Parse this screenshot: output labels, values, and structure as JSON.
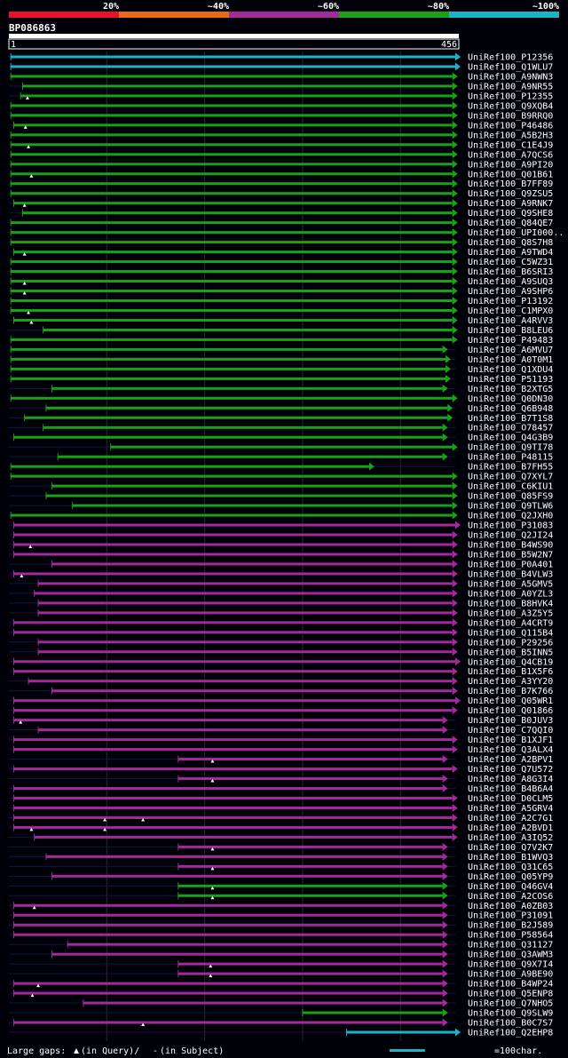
{
  "chart_data": {
    "type": "alignment-overview",
    "query_id": "BP086863",
    "query_length": 456,
    "ruler_start_label": "1",
    "ruler_end_label": "456",
    "identity_legend": [
      {
        "label": "20%",
        "color": "#e8102c"
      },
      {
        "label": "~40%",
        "color": "#e46c15"
      },
      {
        "label": "~60%",
        "color": "#a52a99"
      },
      {
        "label": "~80%",
        "color": "#19a11a"
      },
      {
        "label": "~100%",
        "color": "#1ab5c5"
      }
    ],
    "legend_text": "Large gaps:",
    "legend_query": "(in Query)/",
    "legend_subject_mark": "-",
    "legend_subject": "(in Subject)",
    "scale_label": "=100char.",
    "scale_value": 100,
    "hits": [
      {
        "id": "UniRef100_P12356",
        "s": 2,
        "e": 456,
        "c": "cyan"
      },
      {
        "id": "UniRef100_Q1WLU7",
        "s": 2,
        "e": 456,
        "c": "cyan"
      },
      {
        "id": "UniRef100_A9NWN3",
        "s": 2,
        "e": 453,
        "c": "green"
      },
      {
        "id": "UniRef100_A9NR55",
        "s": 14,
        "e": 453,
        "c": "green"
      },
      {
        "id": "UniRef100_P12355",
        "s": 12,
        "e": 453,
        "c": "green",
        "q": [
          19
        ]
      },
      {
        "id": "UniRef100_Q9XQB4",
        "s": 2,
        "e": 453,
        "c": "green"
      },
      {
        "id": "UniRef100_B9RRQ0",
        "s": 2,
        "e": 453,
        "c": "green"
      },
      {
        "id": "UniRef100_P46486",
        "s": 5,
        "e": 453,
        "c": "green",
        "q": [
          17
        ]
      },
      {
        "id": "UniRef100_A5B2H3",
        "s": 2,
        "e": 453,
        "c": "green"
      },
      {
        "id": "UniRef100_C1E4J9",
        "s": 2,
        "e": 453,
        "c": "green",
        "q": [
          20
        ]
      },
      {
        "id": "UniRef100_A7QCS6",
        "s": 2,
        "e": 453,
        "c": "green"
      },
      {
        "id": "UniRef100_A9PI20",
        "s": 2,
        "e": 453,
        "c": "green"
      },
      {
        "id": "UniRef100_Q01B61",
        "s": 2,
        "e": 453,
        "c": "green",
        "q": [
          23
        ]
      },
      {
        "id": "UniRef100_B7FF89",
        "s": 2,
        "e": 453,
        "c": "green"
      },
      {
        "id": "UniRef100_Q9ZSU5",
        "s": 2,
        "e": 453,
        "c": "green"
      },
      {
        "id": "UniRef100_A9RNK7",
        "s": 5,
        "e": 453,
        "c": "green",
        "q": [
          16
        ]
      },
      {
        "id": "UniRef100_Q9SHE8",
        "s": 14,
        "e": 453,
        "c": "green"
      },
      {
        "id": "UniRef100_Q84QE7",
        "s": 2,
        "e": 453,
        "c": "green"
      },
      {
        "id": "UniRef100_UPI000..",
        "s": 2,
        "e": 453,
        "c": "green"
      },
      {
        "id": "UniRef100_Q8S7H8",
        "s": 2,
        "e": 453,
        "c": "green"
      },
      {
        "id": "UniRef100_A9TWD4",
        "s": 5,
        "e": 453,
        "c": "green",
        "q": [
          16
        ]
      },
      {
        "id": "UniRef100_C5WZ31",
        "s": 2,
        "e": 453,
        "c": "green"
      },
      {
        "id": "UniRef100_B6SRI3",
        "s": 2,
        "e": 453,
        "c": "green"
      },
      {
        "id": "UniRef100_A9SUQ3",
        "s": 2,
        "e": 453,
        "c": "green",
        "q": [
          16
        ]
      },
      {
        "id": "UniRef100_A9SHP6",
        "s": 2,
        "e": 453,
        "c": "green",
        "q": [
          16
        ]
      },
      {
        "id": "UniRef100_P13192",
        "s": 2,
        "e": 453,
        "c": "green"
      },
      {
        "id": "UniRef100_C1MPX0",
        "s": 2,
        "e": 453,
        "c": "green",
        "q": [
          20
        ]
      },
      {
        "id": "UniRef100_A4RVV3",
        "s": 5,
        "e": 453,
        "c": "green",
        "q": [
          23
        ]
      },
      {
        "id": "UniRef100_B8LEU6",
        "s": 35,
        "e": 453,
        "c": "green"
      },
      {
        "id": "UniRef100_P49483",
        "s": 2,
        "e": 453,
        "c": "green"
      },
      {
        "id": "UniRef100_A6MVU7",
        "s": 2,
        "e": 443,
        "c": "green"
      },
      {
        "id": "UniRef100_A0T0M1",
        "s": 2,
        "e": 446,
        "c": "green"
      },
      {
        "id": "UniRef100_Q1XDU4",
        "s": 2,
        "e": 446,
        "c": "green"
      },
      {
        "id": "UniRef100_P51193",
        "s": 2,
        "e": 446,
        "c": "green"
      },
      {
        "id": "UniRef100_B2XTG5",
        "s": 44,
        "e": 443,
        "c": "green"
      },
      {
        "id": "UniRef100_Q0DN30",
        "s": 2,
        "e": 453,
        "c": "green"
      },
      {
        "id": "UniRef100_Q6B948",
        "s": 38,
        "e": 448,
        "c": "green"
      },
      {
        "id": "UniRef100_B7T1S8",
        "s": 16,
        "e": 448,
        "c": "green"
      },
      {
        "id": "UniRef100_O78457",
        "s": 35,
        "e": 443,
        "c": "green"
      },
      {
        "id": "UniRef100_Q4G3B9",
        "s": 5,
        "e": 443,
        "c": "green"
      },
      {
        "id": "UniRef100_Q9TI78",
        "s": 104,
        "e": 453,
        "c": "green"
      },
      {
        "id": "UniRef100_P48115",
        "s": 50,
        "e": 443,
        "c": "green"
      },
      {
        "id": "UniRef100_B7FH55",
        "s": 2,
        "e": 368,
        "c": "green"
      },
      {
        "id": "UniRef100_Q7XYL7",
        "s": 2,
        "e": 453,
        "c": "green"
      },
      {
        "id": "UniRef100_C6KIU1",
        "s": 44,
        "e": 453,
        "c": "green"
      },
      {
        "id": "UniRef100_Q85FS9",
        "s": 38,
        "e": 453,
        "c": "green"
      },
      {
        "id": "UniRef100_Q9TLW6",
        "s": 65,
        "e": 453,
        "c": "green"
      },
      {
        "id": "UniRef100_Q2JXH0",
        "s": 2,
        "e": 453,
        "c": "green"
      },
      {
        "id": "UniRef100_P31083",
        "s": 5,
        "e": 456,
        "c": "magenta"
      },
      {
        "id": "UniRef100_Q2JI24",
        "s": 5,
        "e": 453,
        "c": "magenta"
      },
      {
        "id": "UniRef100_B4WS90",
        "s": 5,
        "e": 453,
        "c": "magenta",
        "q": [
          22
        ]
      },
      {
        "id": "UniRef100_B5W2N7",
        "s": 5,
        "e": 453,
        "c": "magenta"
      },
      {
        "id": "UniRef100_P0A401",
        "s": 44,
        "e": 453,
        "c": "magenta"
      },
      {
        "id": "UniRef100_B4VLW3",
        "s": 5,
        "e": 453,
        "c": "magenta",
        "q": [
          13
        ]
      },
      {
        "id": "UniRef100_A5GMV5",
        "s": 30,
        "e": 453,
        "c": "magenta"
      },
      {
        "id": "UniRef100_A0YZL3",
        "s": 26,
        "e": 453,
        "c": "magenta"
      },
      {
        "id": "UniRef100_B8HVK4",
        "s": 30,
        "e": 453,
        "c": "magenta"
      },
      {
        "id": "UniRef100_A3Z5Y5",
        "s": 30,
        "e": 453,
        "c": "magenta"
      },
      {
        "id": "UniRef100_A4CRT9",
        "s": 5,
        "e": 453,
        "c": "magenta"
      },
      {
        "id": "UniRef100_Q115B4",
        "s": 5,
        "e": 453,
        "c": "magenta"
      },
      {
        "id": "UniRef100_P29256",
        "s": 30,
        "e": 453,
        "c": "magenta"
      },
      {
        "id": "UniRef100_B5INN5",
        "s": 30,
        "e": 453,
        "c": "magenta"
      },
      {
        "id": "UniRef100_Q4CB19",
        "s": 5,
        "e": 456,
        "c": "magenta"
      },
      {
        "id": "UniRef100_B1X5F6",
        "s": 5,
        "e": 453,
        "c": "magenta"
      },
      {
        "id": "UniRef100_A3YY20",
        "s": 20,
        "e": 453,
        "c": "magenta"
      },
      {
        "id": "UniRef100_B7K766",
        "s": 44,
        "e": 453,
        "c": "magenta"
      },
      {
        "id": "UniRef100_Q05WR1",
        "s": 5,
        "e": 456,
        "c": "magenta"
      },
      {
        "id": "UniRef100_Q01866",
        "s": 5,
        "e": 453,
        "c": "magenta"
      },
      {
        "id": "UniRef100_B0JUV3",
        "s": 5,
        "e": 443,
        "c": "magenta",
        "q": [
          12
        ]
      },
      {
        "id": "UniRef100_C7QQI0",
        "s": 30,
        "e": 443,
        "c": "magenta"
      },
      {
        "id": "UniRef100_B1XJF1",
        "s": 5,
        "e": 453,
        "c": "magenta"
      },
      {
        "id": "UniRef100_Q3ALX4",
        "s": 5,
        "e": 453,
        "c": "magenta"
      },
      {
        "id": "UniRef100_A2BPV1",
        "s": 173,
        "e": 443,
        "c": "magenta",
        "q": [
          208
        ]
      },
      {
        "id": "UniRef100_Q7U572",
        "s": 5,
        "e": 453,
        "c": "magenta"
      },
      {
        "id": "UniRef100_A8G3I4",
        "s": 173,
        "e": 443,
        "c": "magenta",
        "q": [
          208
        ]
      },
      {
        "id": "UniRef100_B4B6A4",
        "s": 5,
        "e": 443,
        "c": "magenta"
      },
      {
        "id": "UniRef100_D0CLM5",
        "s": 5,
        "e": 453,
        "c": "magenta"
      },
      {
        "id": "UniRef100_A5GRV4",
        "s": 5,
        "e": 453,
        "c": "magenta"
      },
      {
        "id": "UniRef100_A2C7G1",
        "s": 5,
        "e": 453,
        "c": "magenta",
        "q": [
          98,
          137
        ]
      },
      {
        "id": "UniRef100_A2BVD1",
        "s": 5,
        "e": 453,
        "c": "magenta",
        "q": [
          23,
          98
        ]
      },
      {
        "id": "UniRef100_A3IQ52",
        "s": 26,
        "e": 453,
        "c": "magenta"
      },
      {
        "id": "UniRef100_Q7V2K7",
        "s": 173,
        "e": 443,
        "c": "magenta",
        "q": [
          208
        ]
      },
      {
        "id": "UniRef100_B1WVQ3",
        "s": 38,
        "e": 443,
        "c": "magenta"
      },
      {
        "id": "UniRef100_Q31C65",
        "s": 173,
        "e": 443,
        "c": "magenta",
        "q": [
          208
        ]
      },
      {
        "id": "UniRef100_Q05YP9",
        "s": 44,
        "e": 443,
        "c": "magenta"
      },
      {
        "id": "UniRef100_Q46GV4",
        "s": 173,
        "e": 443,
        "c": "green",
        "q": [
          208
        ]
      },
      {
        "id": "UniRef100_A2COS6",
        "s": 173,
        "e": 443,
        "c": "green",
        "q": [
          208
        ]
      },
      {
        "id": "UniRef100_A0ZB03",
        "s": 5,
        "e": 443,
        "c": "magenta",
        "q": [
          26
        ]
      },
      {
        "id": "UniRef100_P31091",
        "s": 5,
        "e": 443,
        "c": "magenta"
      },
      {
        "id": "UniRef100_B2J589",
        "s": 5,
        "e": 443,
        "c": "magenta"
      },
      {
        "id": "UniRef100_P58564",
        "s": 5,
        "e": 443,
        "c": "magenta"
      },
      {
        "id": "UniRef100_Q31127",
        "s": 60,
        "e": 443,
        "c": "magenta"
      },
      {
        "id": "UniRef100_Q3AWM3",
        "s": 44,
        "e": 443,
        "c": "magenta"
      },
      {
        "id": "UniRef100_Q9X7I4",
        "s": 173,
        "e": 443,
        "c": "magenta",
        "q": [
          206
        ]
      },
      {
        "id": "UniRef100_A9BE90",
        "s": 173,
        "e": 443,
        "c": "magenta",
        "q": [
          206
        ]
      },
      {
        "id": "UniRef100_B4WP24",
        "s": 5,
        "e": 443,
        "c": "magenta",
        "q": [
          30
        ]
      },
      {
        "id": "UniRef100_Q5ENP8",
        "s": 5,
        "e": 443,
        "c": "magenta",
        "q": [
          24
        ]
      },
      {
        "id": "UniRef100_Q7NHO5",
        "s": 76,
        "e": 443,
        "c": "magenta"
      },
      {
        "id": "UniRef100_Q9SLW9",
        "s": 300,
        "e": 443,
        "c": "green"
      },
      {
        "id": "UniRef100_B0C7S7",
        "s": 5,
        "e": 443,
        "c": "magenta",
        "q": [
          137
        ]
      },
      {
        "id": "UniRef100_Q2EHP8",
        "s": 345,
        "e": 456,
        "c": "cyan"
      }
    ]
  }
}
